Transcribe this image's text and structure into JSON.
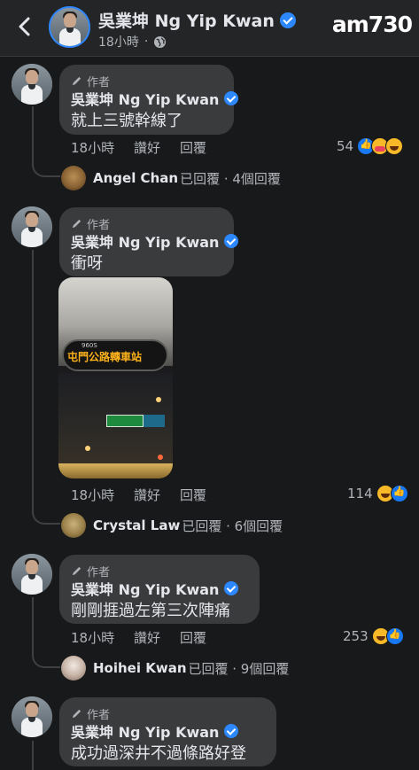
{
  "header": {
    "name": "吳業坤 Ng Yip Kwan",
    "time": "18小時",
    "dot": "·",
    "watermark": "am730"
  },
  "comments": [
    {
      "author_tag": "作者",
      "name": "吳業坤 Ng Yip Kwan",
      "text": "就上三號幹線了",
      "time": "18小時",
      "like": "讚好",
      "reply": "回覆",
      "reaction_count": "54",
      "reactions": [
        "like-icon",
        "care-icon",
        "haha-icon"
      ],
      "replies": {
        "name": "Angel Chan",
        "status": "已回覆 · 4個回覆"
      }
    },
    {
      "author_tag": "作者",
      "name": "吳業坤 Ng Yip Kwan",
      "text": "衝呀",
      "photo_led": "屯門公路轉車站",
      "photo_route": "960S",
      "time": "18小時",
      "like": "讚好",
      "reply": "回覆",
      "reaction_count": "114",
      "reactions": [
        "haha-icon",
        "like-icon"
      ],
      "replies": {
        "name": "Crystal Law",
        "status": "已回覆 · 6個回覆"
      }
    },
    {
      "author_tag": "作者",
      "name": "吳業坤 Ng Yip Kwan",
      "text": "剛剛捱過左第三次陣痛",
      "time": "18小時",
      "like": "讚好",
      "reply": "回覆",
      "reaction_count": "253",
      "reactions": [
        "haha-icon",
        "like-icon"
      ],
      "replies": {
        "name": "Hoihei Kwan",
        "status": "已回覆 · 9個回覆"
      }
    },
    {
      "author_tag": "作者",
      "name": "吳業坤 Ng Yip Kwan",
      "text": "成功過深井不過條路好登"
    }
  ],
  "colors": {
    "background": "#18191a",
    "bubble": "#3a3b3c",
    "verified": "#2d88ff",
    "secondary_text": "#b0b3b8"
  }
}
